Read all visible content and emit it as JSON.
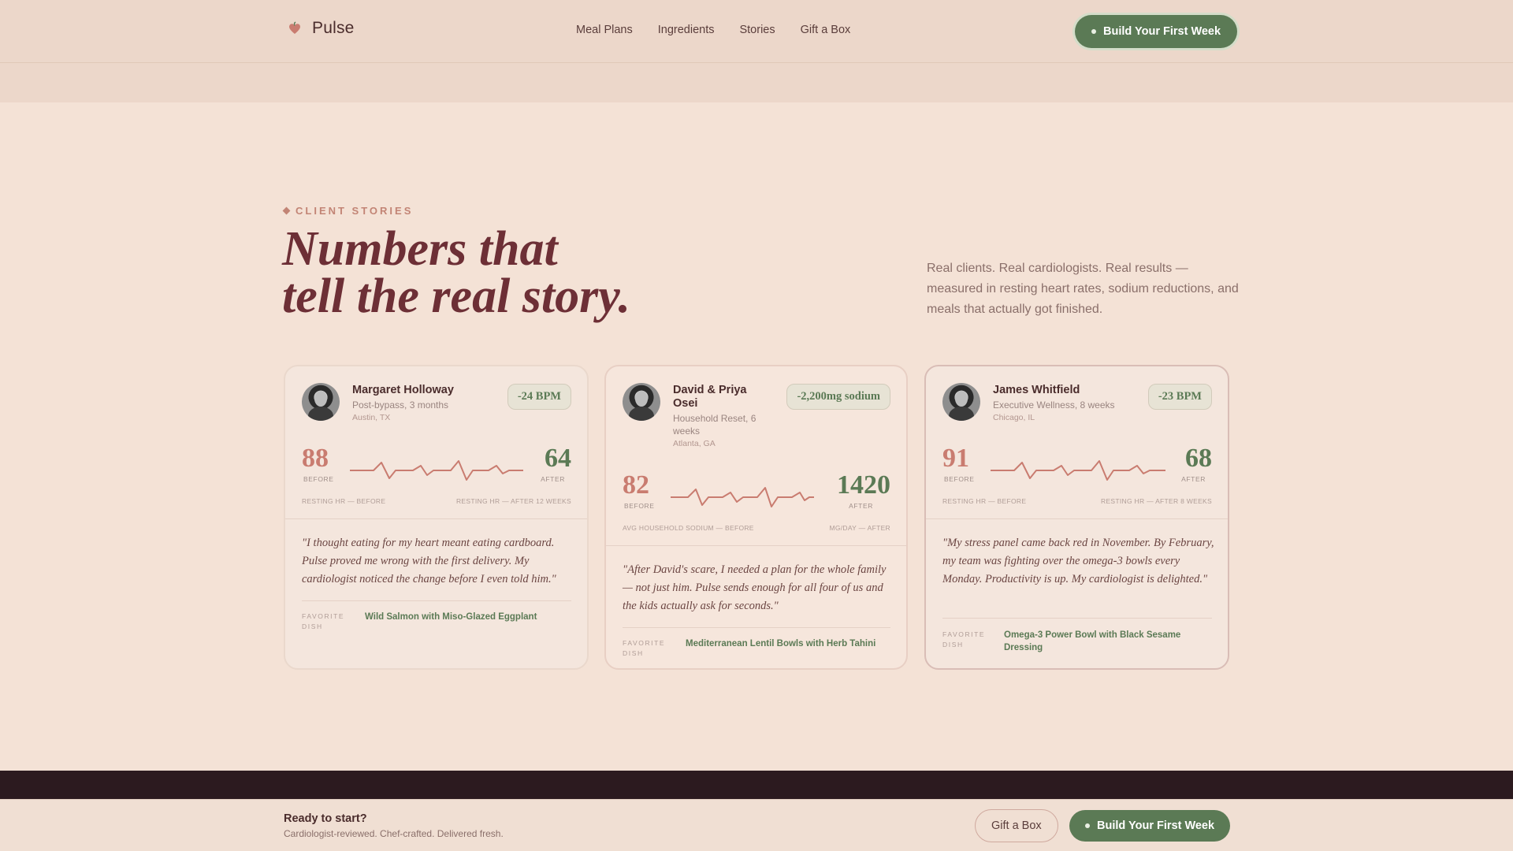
{
  "header": {
    "brand": "Pulse",
    "nav": [
      "Meal Plans",
      "Ingredients",
      "Stories",
      "Gift a Box"
    ],
    "cta": "Build Your First Week"
  },
  "hero": {
    "eyebrow": "CLIENT STORIES",
    "title_line1": "Numbers that",
    "title_line2": "tell the real story.",
    "description": "Real clients. Real cardiologists. Real results — measured in resting heart rates, sodium reductions, and meals that actually got finished."
  },
  "stories": [
    {
      "name": "Margaret Holloway",
      "program": "Post-bypass, 3 months",
      "location": "Austin, TX",
      "badge": "-24 BPM",
      "before": "88",
      "after": "64",
      "before_tag": "BEFORE",
      "after_tag": "AFTER",
      "caption_left": "RESTING HR — BEFORE",
      "caption_right": "RESTING HR — AFTER 12 WEEKS",
      "quote": "\"I thought eating for my heart meant eating cardboard. Pulse proved me wrong with the first delivery. My cardiologist noticed the change before I even told him.\"",
      "favorite_label": "FAVORITE DISH",
      "favorite_dish": "Wild Salmon with Miso-Glazed Eggplant"
    },
    {
      "name": "David & Priya Osei",
      "program": "Household Reset, 6 weeks",
      "location": "Atlanta, GA",
      "badge": "-2,200mg sodium",
      "before": "82",
      "after": "1420",
      "before_tag": "BEFORE",
      "after_tag": "AFTER",
      "caption_left": "AVG HOUSEHOLD SODIUM — BEFORE",
      "caption_right": "MG/DAY — AFTER",
      "quote": "\"After David's scare, I needed a plan for the whole family — not just him. Pulse sends enough for all four of us and the kids actually ask for seconds.\"",
      "favorite_label": "FAVORITE DISH",
      "favorite_dish": "Mediterranean Lentil Bowls with Herb Tahini"
    },
    {
      "name": "James Whitfield",
      "program": "Executive Wellness, 8 weeks",
      "location": "Chicago, IL",
      "badge": "-23 BPM",
      "before": "91",
      "after": "68",
      "before_tag": "BEFORE",
      "after_tag": "AFTER",
      "caption_left": "RESTING HR — BEFORE",
      "caption_right": "RESTING HR — AFTER 8 WEEKS",
      "quote": "\"My stress panel came back red in November. By February, my team was fighting over the omega-3 bowls every Monday. Productivity is up. My cardiologist is delighted.\"",
      "favorite_label": "FAVORITE DISH",
      "favorite_dish": "Omega-3 Power Bowl with Black Sesame Dressing"
    }
  ],
  "cta_bar": {
    "title": "Ready to start?",
    "subtitle": "Cardiologist-reviewed. Chef-crafted. Delivered fresh.",
    "secondary": "Gift a Box",
    "primary": "Build Your First Week"
  },
  "colors": {
    "background": "#f4e2d6",
    "accent_green": "#5b7a55",
    "accent_rose": "#c97c70",
    "title_wine": "#6d2f36",
    "dark_band": "#2c1a1f"
  }
}
